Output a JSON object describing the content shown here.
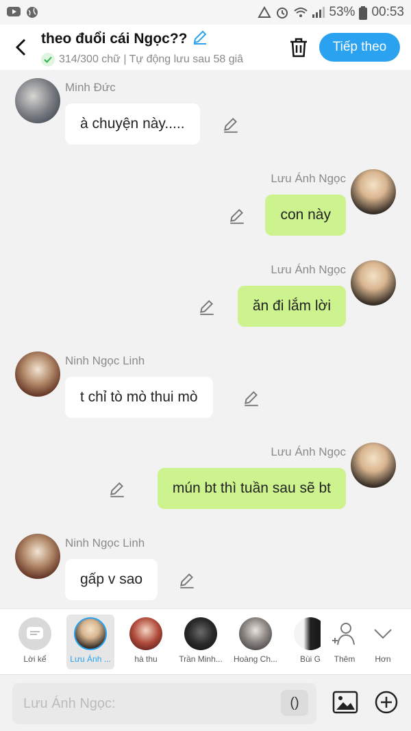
{
  "status_bar": {
    "battery": "53%",
    "time": "00:53"
  },
  "header": {
    "title": "theo đuổi cái Ngọc??",
    "subtitle": "314/300 chữ | Tự động lưu sau 58 giâ",
    "next_label": "Tiếp theo"
  },
  "messages": [
    {
      "side": "left",
      "name": "Minh Đức",
      "text": "à chuyện này....."
    },
    {
      "side": "right",
      "name": "Lưu Ánh Ngọc",
      "text": "con này"
    },
    {
      "side": "right",
      "name": "Lưu Ánh Ngọc",
      "text": "ăn đi lắm lời"
    },
    {
      "side": "left",
      "name": "Ninh Ngọc Linh",
      "text": "t chỉ tò mò thui mò"
    },
    {
      "side": "right",
      "name": "Lưu Ánh Ngọc",
      "text": "mún bt thì tuần sau sẽ bt"
    },
    {
      "side": "left",
      "name": "Ninh Ngọc Linh",
      "text": "gấp v sao"
    }
  ],
  "characters": [
    {
      "label": "Lời kể"
    },
    {
      "label": "Lưu Ánh ..."
    },
    {
      "label": "hà thu"
    },
    {
      "label": "Trần Minh..."
    },
    {
      "label": "Hoàng Ch..."
    },
    {
      "label": "Bùi G"
    },
    {
      "label": "Thêm"
    },
    {
      "label": "Hơn"
    }
  ],
  "input": {
    "placeholder": "Lưu Ánh Ngọc:",
    "paren_label": "()"
  }
}
